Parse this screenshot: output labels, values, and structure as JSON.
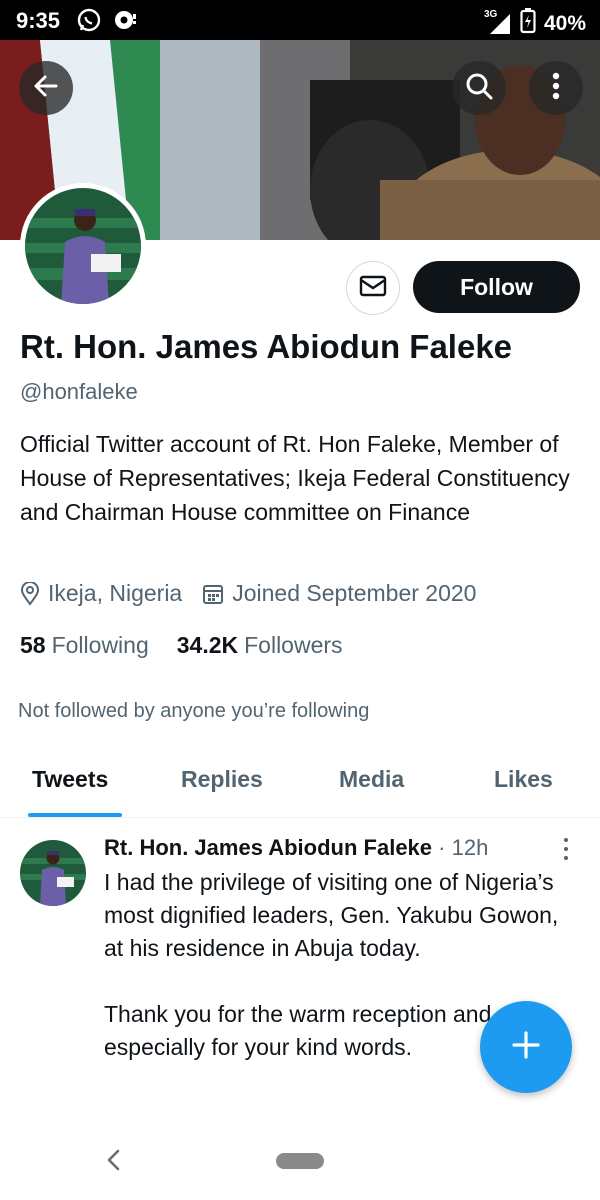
{
  "status_bar": {
    "time": "9:35",
    "network": "3G",
    "battery": "40%"
  },
  "profile": {
    "name": "Rt. Hon. James Abiodun Faleke",
    "handle": "@honfaleke",
    "bio": "Official Twitter account of Rt. Hon Faleke, Member of House of Representatives; Ikeja Federal Constituency and Chairman House committee on Finance",
    "location": "Ikeja, Nigeria",
    "joined": "Joined September 2020",
    "following_count": "58",
    "following_label": "Following",
    "followers_count": "34.2K",
    "followers_label": "Followers",
    "follow_button": "Follow",
    "not_followed_note": "Not followed by anyone you’re following"
  },
  "tabs": [
    {
      "label": "Tweets",
      "active": true
    },
    {
      "label": "Replies",
      "active": false
    },
    {
      "label": "Media",
      "active": false
    },
    {
      "label": "Likes",
      "active": false
    }
  ],
  "tweet": {
    "author": "Rt. Hon. James Abiodun Faleke",
    "separator": "·",
    "time": "12h",
    "paragraphs": [
      "I had the privilege of visiting one of Nigeria’s most dignified leaders, Gen. Yakubu Gowon, at his residence in Abuja today.",
      "Thank you for the warm reception and most especially for your kind words."
    ]
  },
  "colors": {
    "accent": "#1d9bf0",
    "text_primary": "#0f1419",
    "text_secondary": "#536471",
    "follow_button_bg": "#0f1419"
  },
  "icons": {
    "back": "arrow-left-icon",
    "search": "search-icon",
    "more": "more-vertical-icon",
    "message": "envelope-icon",
    "location": "location-pin-icon",
    "calendar": "calendar-icon",
    "compose": "plus-icon"
  }
}
